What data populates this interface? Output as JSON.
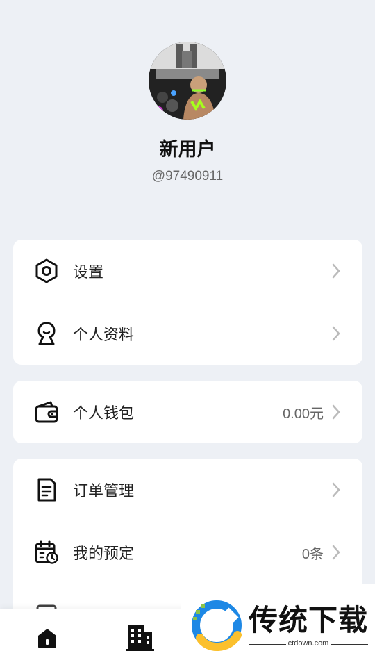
{
  "profile": {
    "name": "新用户",
    "user_id": "@97490911"
  },
  "menu_group_1": [
    {
      "label": "设置",
      "icon": "settings-icon"
    },
    {
      "label": "个人资料",
      "icon": "profile-icon"
    }
  ],
  "menu_group_2": [
    {
      "label": "个人钱包",
      "value": "0.00元",
      "icon": "wallet-icon"
    }
  ],
  "menu_group_3": [
    {
      "label": "订单管理",
      "icon": "order-icon"
    },
    {
      "label": "我的预定",
      "value": "0条",
      "icon": "calendar-icon"
    }
  ],
  "tabbar": [
    {
      "icon": "home-icon"
    },
    {
      "icon": "building-icon"
    }
  ],
  "watermark": {
    "title": "传统下载",
    "url": "ctdown.com"
  },
  "colors": {
    "background": "#edf0f5",
    "card": "#ffffff",
    "text": "#222222",
    "secondary": "#666666"
  }
}
